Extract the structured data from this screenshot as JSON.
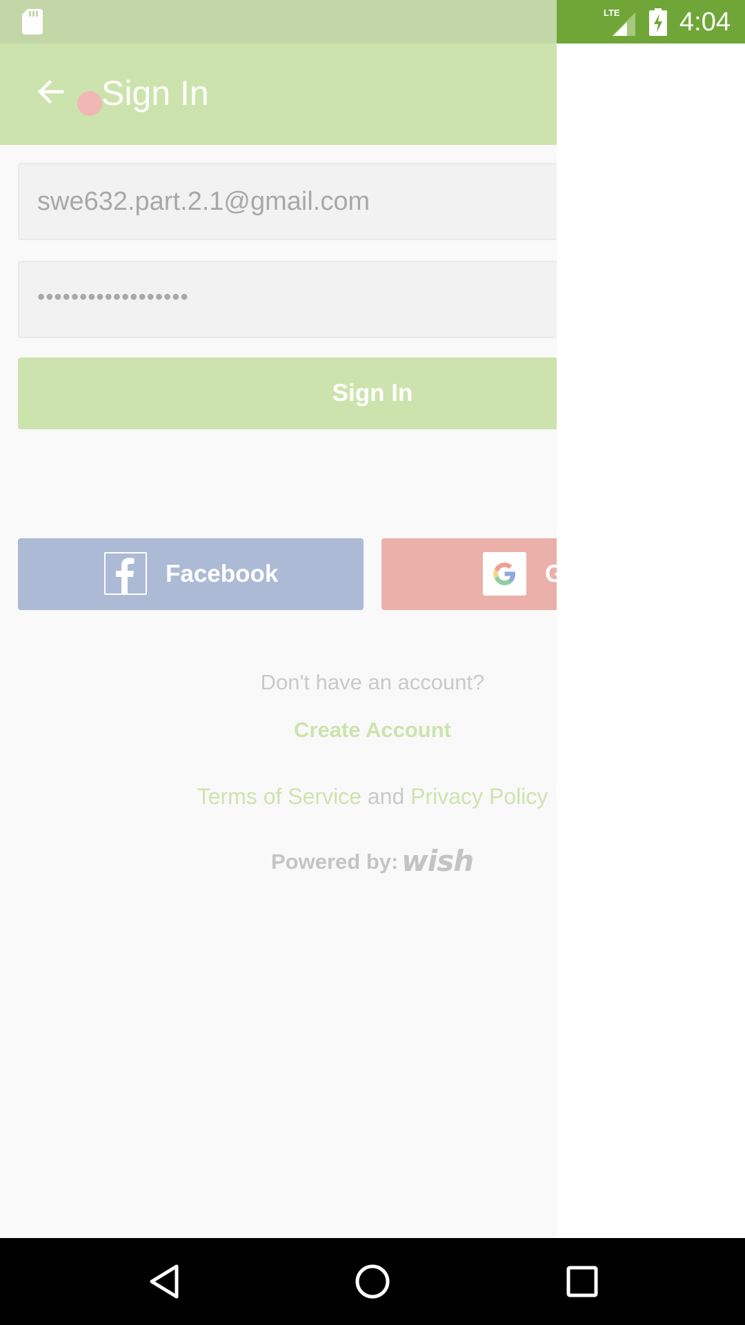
{
  "status_bar": {
    "time": "4:04",
    "network": "LTE",
    "icons": [
      "sd-card-icon",
      "lte-signal-icon",
      "battery-charging-icon"
    ],
    "colors": {
      "left": "#c3d6a7",
      "right": "#70a638"
    }
  },
  "app_bar": {
    "title": "Sign In",
    "back_icon": "arrow-back-icon",
    "color": "#cde3ad"
  },
  "form": {
    "email_value": "swe632.part.2.1@gmail.com",
    "password_value": "••••••••••••••••••",
    "signin_label": "Sign In"
  },
  "social": {
    "facebook_label": "Facebook",
    "facebook_icon": "facebook-icon",
    "facebook_color": "#acbad6",
    "google_label": "G",
    "google_icon": "google-icon",
    "google_color": "#ebb0a9"
  },
  "footer": {
    "no_account_text": "Don't have an account?",
    "create_account_label": "Create Account",
    "terms_label": "Terms of Service",
    "and_text": " and ",
    "privacy_label": "Privacy Policy",
    "powered_by_text": "Powered by:",
    "wish_logo_text": "wish"
  },
  "nav_bar": {
    "icons": [
      "nav-back-icon",
      "nav-home-icon",
      "nav-recents-icon"
    ]
  }
}
